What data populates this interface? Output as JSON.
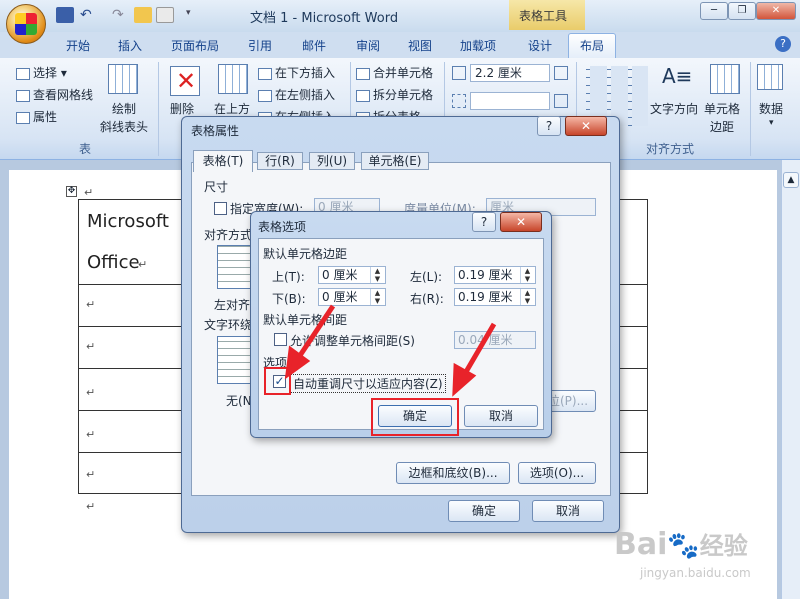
{
  "window": {
    "title": "文档 1 - Microsoft Word",
    "context_tab_group": "表格工具"
  },
  "tabs": [
    "开始",
    "插入",
    "页面布局",
    "引用",
    "邮件",
    "审阅",
    "视图",
    "加载项",
    "设计",
    "布局"
  ],
  "active_tab": "布局",
  "ribbon": {
    "select": "选择",
    "view_gridlines": "查看网格线",
    "properties": "属性",
    "draw_diag": "绘制",
    "draw_diag2": "斜线表头",
    "group_table": "表",
    "delete": "删除",
    "insert_above": "在上方",
    "insert_below": "在下方插入",
    "insert_left": "在左侧插入",
    "insert_right": "在右侧插入",
    "merge_cells": "合并单元格",
    "split_cells": "拆分单元格",
    "split_table": "拆分表格",
    "height_value": "2.2 厘米",
    "text_direction": "文字方向",
    "cell_margins": "单元格",
    "cell_margins2": "边距",
    "group_align": "对齐方式",
    "data": "数据"
  },
  "document": {
    "cell_text_1": "Microsoft",
    "cell_text_2": "Office"
  },
  "table_props": {
    "title": "表格属性",
    "tabs": [
      "表格(T)",
      "行(R)",
      "列(U)",
      "单元格(E)"
    ],
    "size_label": "尺寸",
    "specify_width": "指定宽度(W):",
    "width_value": "0 厘米",
    "unit_label": "度量单位(M):",
    "unit_value": "厘米",
    "align_label": "对齐方式",
    "left_align": "左对齐",
    "wrap_label": "文字环绕",
    "wrap_none": "无(N)",
    "positioning_btn": "定位(P)...",
    "borders_btn": "边框和底纹(B)...",
    "options_btn": "选项(O)...",
    "ok": "确定",
    "cancel": "取消"
  },
  "table_options": {
    "title": "表格选项",
    "default_margins": "默认单元格边距",
    "top_label": "上(T):",
    "top_value": "0 厘米",
    "left_label": "左(L):",
    "left_value": "0.19 厘米",
    "bottom_label": "下(B):",
    "bottom_value": "0 厘米",
    "right_label": "右(R):",
    "right_value": "0.19 厘米",
    "default_spacing": "默认单元格间距",
    "allow_spacing": "允许调整单元格间距(S)",
    "spacing_value": "0.04 厘米",
    "options_label": "选项",
    "auto_resize": "自动重调尺寸以适应内容(Z)",
    "auto_resize_checked": true,
    "ok": "确定",
    "cancel": "取消"
  },
  "watermark": {
    "brand": "Bai",
    "brand2": "经验",
    "url": "jingyan.baidu.com"
  },
  "colors": {
    "accent": "#e8232a"
  }
}
